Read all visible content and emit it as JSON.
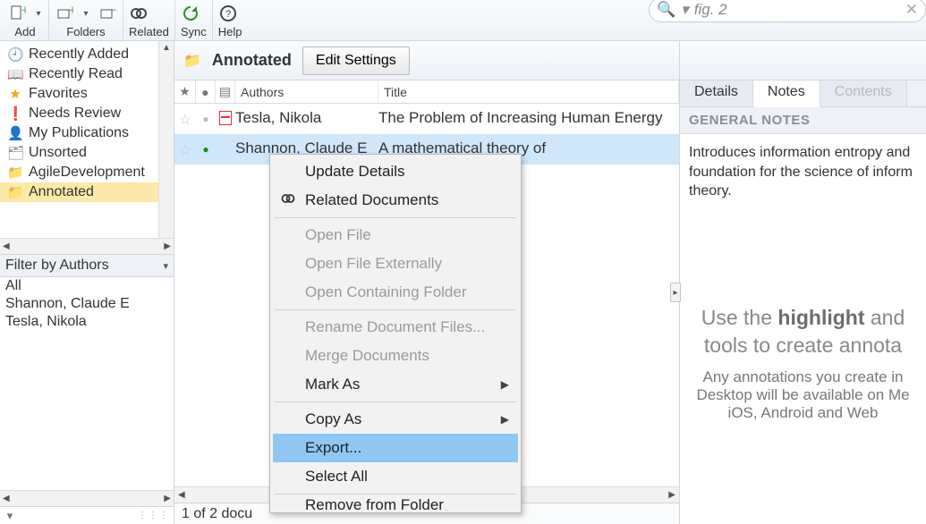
{
  "toolbar": {
    "groups": {
      "add": "Add",
      "folders": "Folders",
      "related": "Related",
      "sync": "Sync",
      "help": "Help"
    },
    "search": {
      "value": "fig. 2"
    }
  },
  "sidebar": {
    "items": [
      {
        "icon": "🕘",
        "label": "Recently Added"
      },
      {
        "icon": "📖",
        "label": "Recently Read"
      },
      {
        "icon": "★",
        "label": "Favorites",
        "iconColor": "#e6b000"
      },
      {
        "icon": "❗",
        "label": "Needs Review",
        "iconColor": "#d43f2a"
      },
      {
        "icon": "👤",
        "label": "My Publications"
      },
      {
        "icon": "🗂",
        "label": "Unsorted"
      },
      {
        "icon": "📁",
        "label": "AgileDevelopment",
        "iconColor": "#d9a93f"
      },
      {
        "icon": "📁",
        "label": "Annotated",
        "iconColor": "#d9a93f",
        "selected": true
      }
    ],
    "filter": {
      "header": "Filter by Authors",
      "rows": [
        "All",
        "Shannon, Claude E",
        "Tesla, Nikola"
      ]
    }
  },
  "folder": {
    "name": "Annotated",
    "editButton": "Edit Settings"
  },
  "columns": {
    "authors": "Authors",
    "title": "Title"
  },
  "documents": [
    {
      "dot": "grey",
      "hasPdf": true,
      "author": "Tesla, Nikola",
      "title": "The Problem of Increasing Human Energy",
      "selected": false
    },
    {
      "dot": "green",
      "hasPdf": false,
      "author": "Shannon, Claude E",
      "title": "A mathematical theory of",
      "selected": true
    }
  ],
  "status": "1 of 2 docu",
  "rightPanel": {
    "tabs": {
      "details": "Details",
      "notes": "Notes",
      "contents": "Contents"
    },
    "generalNotesHeader": "GENERAL NOTES",
    "generalNotes": "Introduces information entropy and foundation for the science of inform theory.",
    "promoBig1": "Use the ",
    "promoBigBold": "highlight",
    "promoBig2": " and",
    "promoLine2": "tools to create annota",
    "promoSmall1": "Any annotations you create in",
    "promoSmall2": "Desktop will be available on Me",
    "promoSmall3": "iOS, Android and Web"
  },
  "contextMenu": {
    "updateDetails": "Update Details",
    "relatedDocs": "Related Documents",
    "openFile": "Open File",
    "openExternal": "Open File Externally",
    "openFolder": "Open Containing Folder",
    "renameFiles": "Rename Document Files...",
    "merge": "Merge Documents",
    "markAs": "Mark As",
    "copyAs": "Copy As",
    "export": "Export...",
    "selectAll": "Select All",
    "removeFolder": "Remove from Folder"
  }
}
